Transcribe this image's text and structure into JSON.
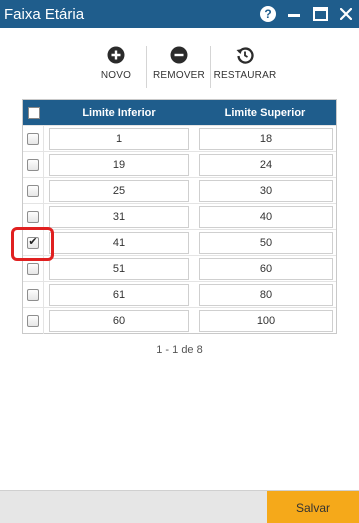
{
  "window": {
    "title": "Faixa Etária",
    "help_label": "?"
  },
  "toolbar": {
    "novo_label": "NOVO",
    "remover_label": "REMOVER",
    "restaurar_label": "RESTAURAR"
  },
  "table": {
    "columns": [
      "Limite Inferior",
      "Limite Superior"
    ],
    "rows": [
      {
        "lower": "1",
        "upper": "18",
        "checked": false
      },
      {
        "lower": "19",
        "upper": "24",
        "checked": false
      },
      {
        "lower": "25",
        "upper": "30",
        "checked": false
      },
      {
        "lower": "31",
        "upper": "40",
        "checked": false
      },
      {
        "lower": "41",
        "upper": "50",
        "checked": true
      },
      {
        "lower": "51",
        "upper": "60",
        "checked": false
      },
      {
        "lower": "61",
        "upper": "80",
        "checked": false
      },
      {
        "lower": "60",
        "upper": "100",
        "checked": false
      }
    ]
  },
  "pager": {
    "text": "1 - 1 de 8"
  },
  "footer": {
    "save_label": "Salvar"
  },
  "colors": {
    "titlebar": "#1f5d8c",
    "save_button": "#f5a91a",
    "highlight": "#e02020"
  }
}
